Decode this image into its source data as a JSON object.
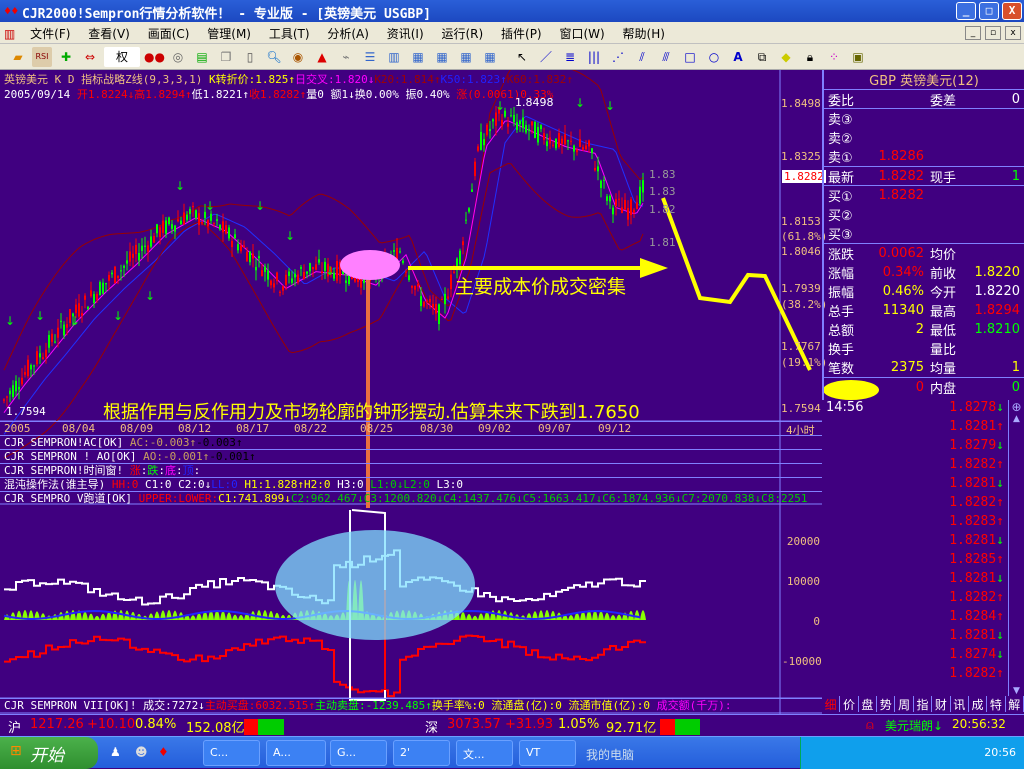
{
  "window": {
    "title": "CJR2000!Sempron行情分析软件！ - 专业版 - [英镑美元 USGBP]",
    "min": "_",
    "max": "□",
    "close": "X"
  },
  "menu": [
    "文件(F)",
    "查看(V)",
    "画面(C)",
    "管理(M)",
    "工具(T)",
    "分析(A)",
    "资讯(I)",
    "运行(R)",
    "插件(P)",
    "窗口(W)",
    "帮助(H)"
  ],
  "toolbar": {
    "weight_label": "权"
  },
  "info": {
    "line1": [
      {
        "t": "英镑美元  K D 指标战略Z线(9,3,3,1) ",
        "c": "#f0c080"
      },
      {
        "t": "K转折价:1.825↑",
        "c": "#ffff00"
      },
      {
        "t": "日交叉:1.820↓",
        "c": "#ff00ff"
      },
      {
        "t": "K20:1.814↑",
        "c": "#a00000"
      },
      {
        "t": "K50:1.823↑",
        "c": "#2020ff"
      },
      {
        "t": "K60:1.832↑",
        "c": "#a00000"
      }
    ],
    "line2": [
      {
        "t": "2005/09/14 ",
        "c": "#fff"
      },
      {
        "t": "开1.8224↓高1.8294↑",
        "c": "#f00"
      },
      {
        "t": "低1.8221↑",
        "c": "#fff"
      },
      {
        "t": "收1.8282↑",
        "c": "#f00"
      },
      {
        "t": "量0 额1↓换0.00% 振0.40% ",
        "c": "#fff"
      },
      {
        "t": "涨(0.0061)0.33%",
        "c": "#f00"
      }
    ]
  },
  "price_axis": {
    "labels": [
      "1.8498",
      "1.8325",
      "1.8153",
      "(61.8%)",
      "1.8046",
      "1.7939",
      "(38.2%)",
      "1.7767",
      "(19.1%)",
      "1.7594"
    ],
    "current": "1.8282",
    "min_label": "1.7594",
    "side_labels": [
      "1.83",
      "1.83",
      "1.82",
      "1.81"
    ]
  },
  "high_label": "1.8498",
  "date_axis": {
    "labels": [
      "2005",
      "08/04",
      "08/09",
      "08/12",
      "08/17",
      "08/22",
      "08/25",
      "08/30",
      "09/02",
      "09/07",
      "09/12"
    ],
    "period": "4小时"
  },
  "annotations": {
    "cost_text": "主要成本价成交密集",
    "forecast_text": "根据作用与反作用力及市场轮廓的钟形摆动.估算未来下跌到1.7650"
  },
  "price_path": [
    [
      0,
      1.76
    ],
    [
      20,
      1.768
    ],
    [
      40,
      1.775
    ],
    [
      70,
      1.786
    ],
    [
      100,
      1.795
    ],
    [
      130,
      1.803
    ],
    [
      160,
      1.812
    ],
    [
      190,
      1.817
    ],
    [
      220,
      1.813
    ],
    [
      250,
      1.805
    ],
    [
      280,
      1.796
    ],
    [
      310,
      1.801
    ],
    [
      340,
      1.8
    ],
    [
      370,
      1.797
    ],
    [
      400,
      1.806
    ],
    [
      420,
      1.792
    ],
    [
      440,
      1.787
    ],
    [
      460,
      1.805
    ],
    [
      480,
      1.838
    ],
    [
      500,
      1.846
    ],
    [
      530,
      1.842
    ],
    [
      560,
      1.838
    ],
    [
      590,
      1.836
    ],
    [
      610,
      1.82
    ],
    [
      630,
      1.818
    ],
    [
      645,
      1.825
    ]
  ],
  "right_panel": {
    "title": "GBP 英镑美元(12)",
    "weibi": "委比",
    "weicha": "委差",
    "weicha_v": "0",
    "sells": [
      {
        "k": "卖③",
        "v": ""
      },
      {
        "k": "卖②",
        "v": ""
      },
      {
        "k": "卖①",
        "v": "1.8286"
      }
    ],
    "latest": {
      "k": "最新",
      "v": "1.8282",
      "k2": "现手",
      "v2": "1"
    },
    "buys": [
      {
        "k": "买①",
        "v": "1.8282"
      },
      {
        "k": "买②",
        "v": ""
      },
      {
        "k": "买③",
        "v": ""
      }
    ],
    "stats": [
      {
        "k": "涨跌",
        "v": "0.0062",
        "vc": "#f00",
        "k2": "均价",
        "v2": "",
        "v2c": "#fff"
      },
      {
        "k": "涨幅",
        "v": "0.34%",
        "vc": "#f00",
        "k2": "前收",
        "v2": "1.8220",
        "v2c": "#ff0"
      },
      {
        "k": "振幅",
        "v": "0.46%",
        "vc": "#ff0",
        "k2": "今开",
        "v2": "1.8220",
        "v2c": "#fff"
      },
      {
        "k": "总手",
        "v": "11340",
        "vc": "#ff0",
        "k2": "最高",
        "v2": "1.8294",
        "v2c": "#f00"
      },
      {
        "k": "总额",
        "v": "2",
        "vc": "#ff0",
        "k2": "最低",
        "v2": "1.8210",
        "v2c": "#0f0"
      },
      {
        "k": "换手",
        "v": "",
        "vc": "#fff",
        "k2": "量比",
        "v2": "",
        "v2c": "#fff"
      },
      {
        "k": "笔数",
        "v": "2375",
        "vc": "#ff0",
        "k2": "均量",
        "v2": "1",
        "v2c": "#ff0"
      }
    ],
    "waipan": {
      "k": "",
      "v": "0",
      "k2": "内盘",
      "v2": "0"
    },
    "time": "14:56",
    "ticks": [
      {
        "p": "1.8278",
        "d": "down"
      },
      {
        "p": "1.8281",
        "d": "up"
      },
      {
        "p": "1.8279",
        "d": "down"
      },
      {
        "p": "1.8282",
        "d": "up"
      },
      {
        "p": "1.8281",
        "d": "down"
      },
      {
        "p": "1.8282",
        "d": "up"
      },
      {
        "p": "1.8283",
        "d": "up"
      },
      {
        "p": "1.8281",
        "d": "down"
      },
      {
        "p": "1.8285",
        "d": "up"
      },
      {
        "p": "1.8281",
        "d": "down"
      },
      {
        "p": "1.8282",
        "d": "up"
      },
      {
        "p": "1.8284",
        "d": "up"
      },
      {
        "p": "1.8281",
        "d": "down"
      },
      {
        "p": "1.8274",
        "d": "down"
      },
      {
        "p": "1.8282",
        "d": "up"
      }
    ],
    "tabs": [
      "细",
      "价",
      "盘",
      "势",
      "周",
      "指",
      "财",
      "讯",
      "成",
      "特",
      "解"
    ]
  },
  "indicators": [
    [
      {
        "t": "CJR SEMPRON!AC[OK] ",
        "c": "#fff"
      },
      {
        "t": "AC:-0.003↑",
        "c": "#c8a060"
      },
      {
        "t": "-0.003↑",
        "c": "#000"
      }
    ],
    [
      {
        "t": "CJR SEMPRON ! AO[OK] ",
        "c": "#fff"
      },
      {
        "t": "AO:-0.001↑",
        "c": "#c8a060"
      },
      {
        "t": "-0.001↑",
        "c": "#000"
      }
    ],
    [
      {
        "t": "CJR SEMPRON!时间窗! ",
        "c": "#fff"
      },
      {
        "t": "涨",
        "c": "#f00"
      },
      {
        "t": ":",
        "c": "#fff"
      },
      {
        "t": "跌",
        "c": "#0f0"
      },
      {
        "t": ":",
        "c": "#fff"
      },
      {
        "t": "底",
        "c": "#f0f"
      },
      {
        "t": ":",
        "c": "#fff"
      },
      {
        "t": "顶",
        "c": "#22f"
      },
      {
        "t": ":",
        "c": "#fff"
      }
    ],
    [
      {
        "t": "混沌操作法(谁主导) ",
        "c": "#fff"
      },
      {
        "t": "HH:0 ",
        "c": "#f00"
      },
      {
        "t": "C1:0 C2:0↓",
        "c": "#fff"
      },
      {
        "t": "LL:0 ",
        "c": "#22f"
      },
      {
        "t": "H1:1.828↑",
        "c": "#ff0"
      },
      {
        "t": "H2:0 ",
        "c": "#ff0"
      },
      {
        "t": "H3:0 ",
        "c": "#fff"
      },
      {
        "t": "L1:0↓",
        "c": "#0c0"
      },
      {
        "t": "L2:0 ",
        "c": "#0c0"
      },
      {
        "t": "L3:0",
        "c": "#fff"
      }
    ],
    [
      {
        "t": "CJR SEMPRO V跑道[OK] ",
        "c": "#fff"
      },
      {
        "t": "UPPER:LOWER:",
        "c": "#f00"
      },
      {
        "t": "C1:741.899↓",
        "c": "#ff0"
      },
      {
        "t": "C2:962.467↓C3:1200.820↓C4:1437.476↓C5:1663.417↓C6:1874.936↓C7:2070.838↓C8:2251",
        "c": "#0c0"
      }
    ]
  ],
  "osc_axis": [
    "20000",
    "10000",
    "0",
    "-10000"
  ],
  "bottom_indicator": [
    {
      "t": "CJR SEMPRON VII[OK]! 成交:7272↓",
      "c": "#fff"
    },
    {
      "t": "主动买盘:6032.515↑",
      "c": "#f00"
    },
    {
      "t": "主动卖盘:-1239.485↑",
      "c": "#0f0"
    },
    {
      "t": "换手率%:0 流通盘(亿):0 流通市值(亿):0 ",
      "c": "#ff0"
    },
    {
      "t": "成交额(千万):",
      "c": "#f0f"
    }
  ],
  "status": {
    "sh": {
      "name": "沪",
      "price": "1217.26",
      "chg": "+10.10",
      "pct": "0.84%",
      "amt": "152.08亿"
    },
    "sz": {
      "name": "深",
      "price": "3073.57",
      "chg": "+31.93",
      "pct": "1.05%",
      "amt": "92.71亿"
    },
    "ticker": "美元瑞朗↓",
    "clock": "20:56:32"
  },
  "taskbar": {
    "start": "开始",
    "tasks": [
      "C...",
      "A...",
      "G...",
      "2'",
      "文...",
      "VT"
    ],
    "mycomputer": "我的电脑",
    "clock": "20:56"
  },
  "colors": {
    "bg": "#400080",
    "up": "#ff0000",
    "down": "#00ff00",
    "annotation": "#ffff00"
  }
}
